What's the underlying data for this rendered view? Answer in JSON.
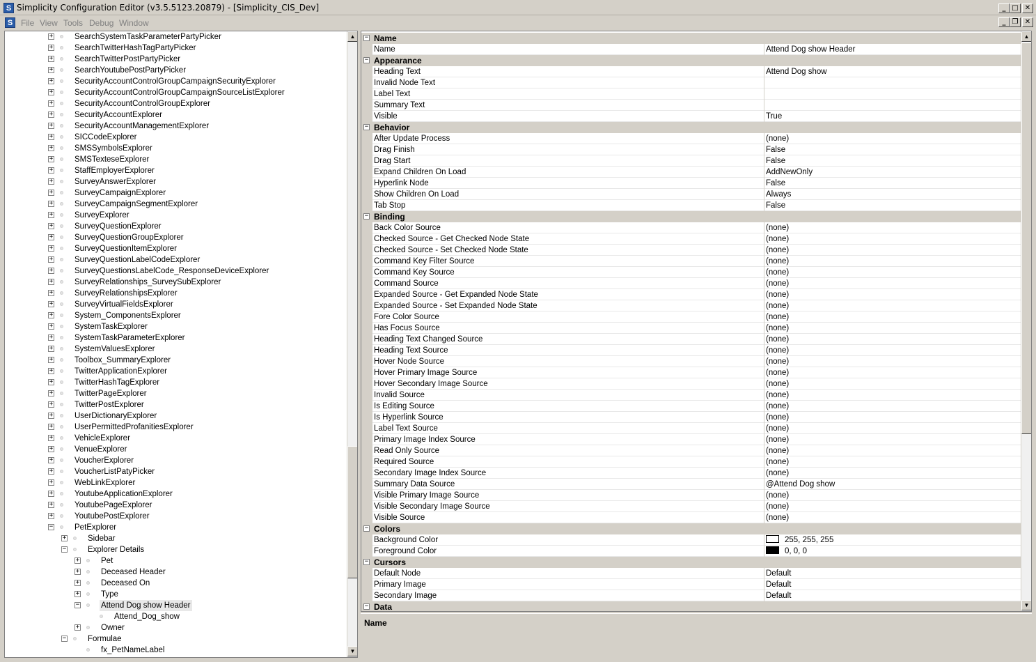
{
  "window": {
    "title": "Simplicity Configuration Editor (v3.5.5123.20879) - [Simplicity_CIS_Dev]",
    "app_icon": "S",
    "controls": [
      "minimize-icon",
      "maximize-icon",
      "close-icon"
    ]
  },
  "menubar": {
    "icon": "S",
    "items": [
      "File",
      "View",
      "Tools",
      "Debug",
      "Window"
    ]
  },
  "tree": {
    "items": [
      {
        "label": "SearchSystemTaskParameterPartyPicker",
        "level": 0,
        "expander": "+"
      },
      {
        "label": "SearchTwitterHashTagPartyPicker",
        "level": 0,
        "expander": "+"
      },
      {
        "label": "SearchTwitterPostPartyPicker",
        "level": 0,
        "expander": "+"
      },
      {
        "label": "SearchYoutubePostPartyPicker",
        "level": 0,
        "expander": "+"
      },
      {
        "label": "SecurityAccountControlGroupCampaignSecurityExplorer",
        "level": 0,
        "expander": "+"
      },
      {
        "label": "SecurityAccountControlGroupCampaignSourceListExplorer",
        "level": 0,
        "expander": "+"
      },
      {
        "label": "SecurityAccountControlGroupExplorer",
        "level": 0,
        "expander": "+"
      },
      {
        "label": "SecurityAccountExplorer",
        "level": 0,
        "expander": "+"
      },
      {
        "label": "SecurityAccountManagementExplorer",
        "level": 0,
        "expander": "+"
      },
      {
        "label": "SICCodeExplorer",
        "level": 0,
        "expander": "+"
      },
      {
        "label": "SMSSymbolsExplorer",
        "level": 0,
        "expander": "+"
      },
      {
        "label": "SMSTexteseExplorer",
        "level": 0,
        "expander": "+"
      },
      {
        "label": "StaffEmployerExplorer",
        "level": 0,
        "expander": "+"
      },
      {
        "label": "SurveyAnswerExplorer",
        "level": 0,
        "expander": "+"
      },
      {
        "label": "SurveyCampaignExplorer",
        "level": 0,
        "expander": "+"
      },
      {
        "label": "SurveyCampaignSegmentExplorer",
        "level": 0,
        "expander": "+"
      },
      {
        "label": "SurveyExplorer",
        "level": 0,
        "expander": "+"
      },
      {
        "label": "SurveyQuestionExplorer",
        "level": 0,
        "expander": "+"
      },
      {
        "label": "SurveyQuestionGroupExplorer",
        "level": 0,
        "expander": "+"
      },
      {
        "label": "SurveyQuestionItemExplorer",
        "level": 0,
        "expander": "+"
      },
      {
        "label": "SurveyQuestionLabelCodeExplorer",
        "level": 0,
        "expander": "+"
      },
      {
        "label": "SurveyQuestionsLabelCode_ResponseDeviceExplorer",
        "level": 0,
        "expander": "+"
      },
      {
        "label": "SurveyRelationships_SurveySubExplorer",
        "level": 0,
        "expander": "+"
      },
      {
        "label": "SurveyRelationshipsExplorer",
        "level": 0,
        "expander": "+"
      },
      {
        "label": "SurveyVirtualFieldsExplorer",
        "level": 0,
        "expander": "+"
      },
      {
        "label": "System_ComponentsExplorer",
        "level": 0,
        "expander": "+"
      },
      {
        "label": "SystemTaskExplorer",
        "level": 0,
        "expander": "+"
      },
      {
        "label": "SystemTaskParameterExplorer",
        "level": 0,
        "expander": "+"
      },
      {
        "label": "SystemValuesExplorer",
        "level": 0,
        "expander": "+"
      },
      {
        "label": "Toolbox_SummaryExplorer",
        "level": 0,
        "expander": "+"
      },
      {
        "label": "TwitterApplicationExplorer",
        "level": 0,
        "expander": "+"
      },
      {
        "label": "TwitterHashTagExplorer",
        "level": 0,
        "expander": "+"
      },
      {
        "label": "TwitterPageExplorer",
        "level": 0,
        "expander": "+"
      },
      {
        "label": "TwitterPostExplorer",
        "level": 0,
        "expander": "+"
      },
      {
        "label": "UserDictionaryExplorer",
        "level": 0,
        "expander": "+"
      },
      {
        "label": "UserPermittedProfanitiesExplorer",
        "level": 0,
        "expander": "+"
      },
      {
        "label": "VehicleExplorer",
        "level": 0,
        "expander": "+"
      },
      {
        "label": "VenueExplorer",
        "level": 0,
        "expander": "+"
      },
      {
        "label": "VoucherExplorer",
        "level": 0,
        "expander": "+"
      },
      {
        "label": "VoucherListPatyPicker",
        "level": 0,
        "expander": "+"
      },
      {
        "label": "WebLinkExplorer",
        "level": 0,
        "expander": "+"
      },
      {
        "label": "YoutubeApplicationExplorer",
        "level": 0,
        "expander": "+"
      },
      {
        "label": "YoutubePageExplorer",
        "level": 0,
        "expander": "+"
      },
      {
        "label": "YoutubePostExplorer",
        "level": 0,
        "expander": "+"
      },
      {
        "label": "PetExplorer",
        "level": 0,
        "expander": "-"
      },
      {
        "label": "Sidebar",
        "level": 1,
        "expander": "+"
      },
      {
        "label": "Explorer Details",
        "level": 1,
        "expander": "-"
      },
      {
        "label": "Pet",
        "level": 2,
        "expander": "+"
      },
      {
        "label": "Deceased Header",
        "level": 2,
        "expander": "+"
      },
      {
        "label": "Deceased On",
        "level": 2,
        "expander": "+"
      },
      {
        "label": "Type",
        "level": 2,
        "expander": "+"
      },
      {
        "label": "Attend Dog show Header",
        "level": 2,
        "expander": "-",
        "selected": true
      },
      {
        "label": "Attend_Dog_show",
        "level": 3,
        "expander": ""
      },
      {
        "label": "Owner",
        "level": 2,
        "expander": "+"
      },
      {
        "label": "Formulae",
        "level": 1,
        "expander": "-"
      },
      {
        "label": "fx_PetNameLabel",
        "level": 2,
        "expander": ""
      }
    ]
  },
  "properties": {
    "rows": [
      {
        "type": "cat",
        "name": "Name"
      },
      {
        "type": "item",
        "name": "Name",
        "value": "Attend Dog show Header"
      },
      {
        "type": "cat",
        "name": "Appearance"
      },
      {
        "type": "item",
        "name": "Heading Text",
        "value": "Attend Dog show"
      },
      {
        "type": "item",
        "name": "Invalid Node Text",
        "value": ""
      },
      {
        "type": "item",
        "name": "Label Text",
        "value": ""
      },
      {
        "type": "item",
        "name": "Summary Text",
        "value": ""
      },
      {
        "type": "item",
        "name": "Visible",
        "value": "True"
      },
      {
        "type": "cat",
        "name": "Behavior"
      },
      {
        "type": "item",
        "name": "After Update Process",
        "value": "(none)"
      },
      {
        "type": "item",
        "name": "Drag Finish",
        "value": "False"
      },
      {
        "type": "item",
        "name": "Drag Start",
        "value": "False"
      },
      {
        "type": "item",
        "name": "Expand Children On Load",
        "value": "AddNewOnly"
      },
      {
        "type": "item",
        "name": "Hyperlink Node",
        "value": "False"
      },
      {
        "type": "item",
        "name": "Show Children On Load",
        "value": "Always"
      },
      {
        "type": "item",
        "name": "Tab Stop",
        "value": "False"
      },
      {
        "type": "cat",
        "name": "Binding"
      },
      {
        "type": "item",
        "name": "Back Color Source",
        "value": "(none)"
      },
      {
        "type": "item",
        "name": "Checked Source - Get Checked Node State",
        "value": "(none)"
      },
      {
        "type": "item",
        "name": "Checked Source - Set Checked Node State",
        "value": "(none)"
      },
      {
        "type": "item",
        "name": "Command Key Filter Source",
        "value": "(none)"
      },
      {
        "type": "item",
        "name": "Command Key Source",
        "value": "(none)"
      },
      {
        "type": "item",
        "name": "Command Source",
        "value": "(none)"
      },
      {
        "type": "item",
        "name": "Expanded Source - Get Expanded Node State",
        "value": "(none)"
      },
      {
        "type": "item",
        "name": "Expanded Source - Set Expanded Node State",
        "value": "(none)"
      },
      {
        "type": "item",
        "name": "Fore Color Source",
        "value": "(none)"
      },
      {
        "type": "item",
        "name": "Has Focus Source",
        "value": "(none)"
      },
      {
        "type": "item",
        "name": "Heading Text Changed Source",
        "value": "(none)"
      },
      {
        "type": "item",
        "name": "Heading Text Source",
        "value": "(none)"
      },
      {
        "type": "item",
        "name": "Hover Node Source",
        "value": "(none)"
      },
      {
        "type": "item",
        "name": "Hover Primary Image Source",
        "value": "(none)"
      },
      {
        "type": "item",
        "name": "Hover Secondary Image Source",
        "value": "(none)"
      },
      {
        "type": "item",
        "name": "Invalid Source",
        "value": "(none)"
      },
      {
        "type": "item",
        "name": "Is Editing Source",
        "value": "(none)"
      },
      {
        "type": "item",
        "name": "Is Hyperlink Source",
        "value": "(none)"
      },
      {
        "type": "item",
        "name": "Label Text Source",
        "value": "(none)"
      },
      {
        "type": "item",
        "name": "Primary Image Index Source",
        "value": "(none)"
      },
      {
        "type": "item",
        "name": "Read Only Source",
        "value": "(none)"
      },
      {
        "type": "item",
        "name": "Required Source",
        "value": "(none)"
      },
      {
        "type": "item",
        "name": "Secondary Image Index Source",
        "value": "(none)"
      },
      {
        "type": "item",
        "name": "Summary Data Source",
        "value": "@Attend Dog show"
      },
      {
        "type": "item",
        "name": "Visible Primary Image Source",
        "value": "(none)"
      },
      {
        "type": "item",
        "name": "Visible Secondary Image Source",
        "value": "(none)"
      },
      {
        "type": "item",
        "name": "Visible Source",
        "value": "(none)"
      },
      {
        "type": "cat",
        "name": "Colors"
      },
      {
        "type": "item",
        "name": "Background Color",
        "value": "255, 255, 255",
        "swatch": "#ffffff"
      },
      {
        "type": "item",
        "name": "Foreground Color",
        "value": "0, 0, 0",
        "swatch": "#000000"
      },
      {
        "type": "cat",
        "name": "Cursors"
      },
      {
        "type": "item",
        "name": "Default Node",
        "value": "Default"
      },
      {
        "type": "item",
        "name": "Primary Image",
        "value": "Default"
      },
      {
        "type": "item",
        "name": "Secondary Image",
        "value": "Default"
      },
      {
        "type": "cat",
        "name": "Data"
      }
    ]
  },
  "description": {
    "title": "Name"
  }
}
